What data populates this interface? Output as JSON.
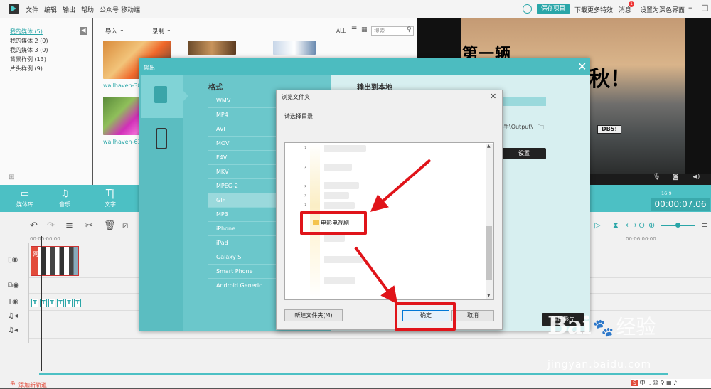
{
  "menubar": {
    "items": [
      "文件",
      "编辑",
      "输出",
      "帮助",
      "公众号",
      "移动端"
    ],
    "save_project": "保存项目",
    "download_effects": "下载更多特效",
    "messages": "消息",
    "message_count": "1",
    "dark_theme": "设置为深色界面"
  },
  "library": {
    "items": [
      "我的媒体 (5)",
      "我的媒体 2 (0)",
      "我的媒体 3 (0)",
      "背景样例 (13)",
      "片头样例 (9)"
    ],
    "import_label": "导入",
    "record_label": "录制",
    "view_all": "ALL",
    "search_placeholder": "搜索",
    "thumb_names": [
      "wallhaven-384",
      "wallhaven-631"
    ]
  },
  "preview": {
    "title_line1": "第一辆",
    "title_line2": "秋！",
    "plate": "DB5!",
    "ratio": "16:9",
    "timecode": "00:00:07.06"
  },
  "tealbar": {
    "tabs": [
      "媒体库",
      "音乐",
      "文字"
    ]
  },
  "timeline": {
    "ruler_start": "00:00:00:00",
    "ruler_mid": "00:06:00:00",
    "clip_label": "网",
    "add_track": "添加新轨道"
  },
  "export": {
    "title": "输出",
    "format_header": "格式",
    "formats": [
      "WMV",
      "MP4",
      "AVI",
      "MOV",
      "F4V",
      "MKV",
      "MPEG-2",
      "GIF",
      "MP3",
      "iPhone",
      "iPad",
      "Galaxy S",
      "Smart Phone",
      "Android Generic"
    ],
    "selected_format": "GIF",
    "output_header": "输出到本地",
    "output_path": "网手\\Output\\",
    "settings_button": "设置",
    "export_button": "输出影片"
  },
  "browse": {
    "title": "浏览文件夹",
    "prompt": "请选择目录",
    "selected_folder": "电影电视剧",
    "new_folder_button": "新建文件夹(M)",
    "ok_button": "确定",
    "cancel_button": "取消"
  },
  "watermark": {
    "brand": "Bai",
    "brand_cn": "经验",
    "url": "jingyan.baidu.com"
  },
  "colors": {
    "accent": "#4cc0c4",
    "annotation": "#e0141a"
  }
}
